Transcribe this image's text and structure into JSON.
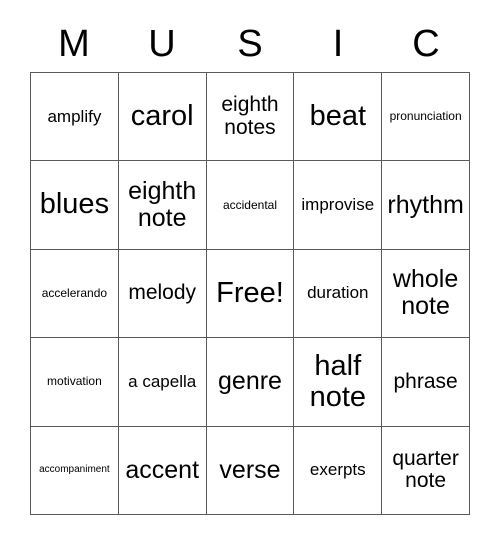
{
  "card": {
    "title_letters": [
      "M",
      "U",
      "S",
      "I",
      "C"
    ],
    "rows": [
      [
        {
          "label": "amplify",
          "size": "fs-m"
        },
        {
          "label": "carol",
          "size": "fs-xxl"
        },
        {
          "label": "eighth notes",
          "size": "fs-l"
        },
        {
          "label": "beat",
          "size": "fs-xxl"
        },
        {
          "label": "pronunciation",
          "size": "fs-s"
        }
      ],
      [
        {
          "label": "blues",
          "size": "fs-xxl"
        },
        {
          "label": "eighth note",
          "size": "fs-xl"
        },
        {
          "label": "accidental",
          "size": "fs-s"
        },
        {
          "label": "improvise",
          "size": "fs-m"
        },
        {
          "label": "rhythm",
          "size": "fs-xl"
        }
      ],
      [
        {
          "label": "accelerando",
          "size": "fs-s"
        },
        {
          "label": "melody",
          "size": "fs-l"
        },
        {
          "label": "Free!",
          "size": "fs-xxl"
        },
        {
          "label": "duration",
          "size": "fs-m"
        },
        {
          "label": "whole note",
          "size": "fs-xl"
        }
      ],
      [
        {
          "label": "motivation",
          "size": "fs-s"
        },
        {
          "label": "a capella",
          "size": "fs-m"
        },
        {
          "label": "genre",
          "size": "fs-xl"
        },
        {
          "label": "half note",
          "size": "fs-xxl"
        },
        {
          "label": "phrase",
          "size": "fs-l"
        }
      ],
      [
        {
          "label": "accompaniment",
          "size": "fs-xs"
        },
        {
          "label": "accent",
          "size": "fs-xl"
        },
        {
          "label": "verse",
          "size": "fs-xl"
        },
        {
          "label": "exerpts",
          "size": "fs-m"
        },
        {
          "label": "quarter note",
          "size": "fs-l"
        }
      ]
    ]
  }
}
